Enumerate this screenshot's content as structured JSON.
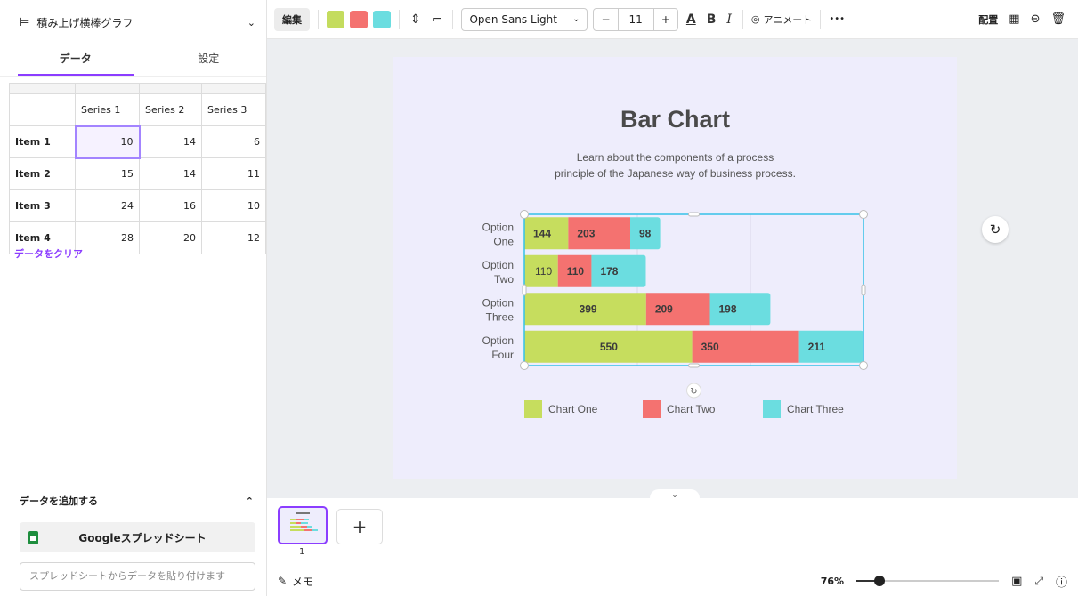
{
  "left_panel": {
    "chart_type_label": "積み上げ横棒グラフ",
    "tabs": [
      {
        "label": "データ",
        "active": true
      },
      {
        "label": "設定",
        "active": false
      }
    ],
    "table": {
      "headers": [
        "",
        "Series 1",
        "Series 2",
        "Series 3"
      ],
      "rows": [
        {
          "label": "Item 1",
          "values": [
            "10",
            "14",
            "6"
          ]
        },
        {
          "label": "Item 2",
          "values": [
            "15",
            "14",
            "11"
          ]
        },
        {
          "label": "Item 3",
          "values": [
            "24",
            "16",
            "10"
          ]
        },
        {
          "label": "Item 4",
          "values": [
            "28",
            "20",
            "12"
          ]
        }
      ]
    },
    "clear_data": "データをクリア",
    "add_data_title": "データを追加する",
    "google_sheets_button": "Googleスプレッドシート",
    "paste_placeholder": "スプレッドシートからデータを貼り付けます"
  },
  "toolbar": {
    "edit_label": "編集",
    "colors": [
      "#c4dc5e",
      "#f47270",
      "#6bdde0"
    ],
    "font_name": "Open Sans Light",
    "font_size": "11",
    "animate_label": "アニメート",
    "more_label": "•••",
    "arrange_label": "配置"
  },
  "canvas": {
    "title": "Bar Chart",
    "subtitle_line1": "Learn about the components of a process",
    "subtitle_line2": "principle of the Japanese way of business process."
  },
  "chart_data": {
    "type": "bar",
    "orientation": "horizontal",
    "stacked": true,
    "categories": [
      [
        "Option",
        "One"
      ],
      [
        "Option",
        "Two"
      ],
      [
        "Option",
        "Three"
      ],
      [
        "Option",
        "Four"
      ]
    ],
    "series": [
      {
        "name": "Chart One",
        "color": "#c6dd5e",
        "values": [
          144,
          110,
          399,
          550
        ]
      },
      {
        "name": "Chart Two",
        "color": "#f47270",
        "values": [
          203,
          110,
          209,
          350
        ]
      },
      {
        "name": "Chart Three",
        "color": "#6bdde0",
        "values": [
          98,
          178,
          198,
          211
        ]
      }
    ],
    "grid": true,
    "legend_position": "bottom"
  },
  "pages": {
    "current_page": "1",
    "add_label": "+"
  },
  "status_bar": {
    "notes_label": "メモ",
    "zoom_percent": "76%",
    "zoom_level": 0.16
  }
}
